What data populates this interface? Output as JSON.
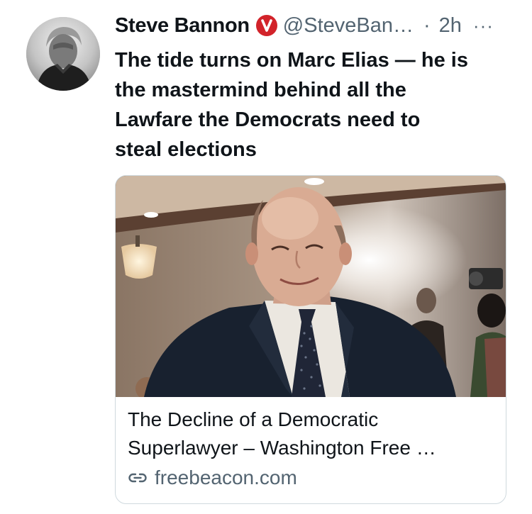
{
  "tweet": {
    "author": {
      "display_name": "Steve Bannon",
      "verified_badge": "V",
      "handle": "@SteveBan…",
      "avatar_icon": "profile-photo"
    },
    "separator": "·",
    "time": "2h",
    "more_label": "···",
    "text_lines": [
      "The tide turns on Marc Elias — he is",
      "the mastermind behind all the",
      "Lawfare the Democrats need to",
      "steal elections"
    ],
    "card": {
      "image_icon": "article-photo",
      "title_lines": [
        "The Decline of a Democratic",
        "Superlawyer – Washington Free …"
      ],
      "link_icon": "link-icon",
      "domain": "freebeacon.com"
    }
  },
  "colors": {
    "text_primary": "#0f1419",
    "text_secondary": "#536471",
    "badge": "#d2232a",
    "card_border": "#cfd9de"
  }
}
